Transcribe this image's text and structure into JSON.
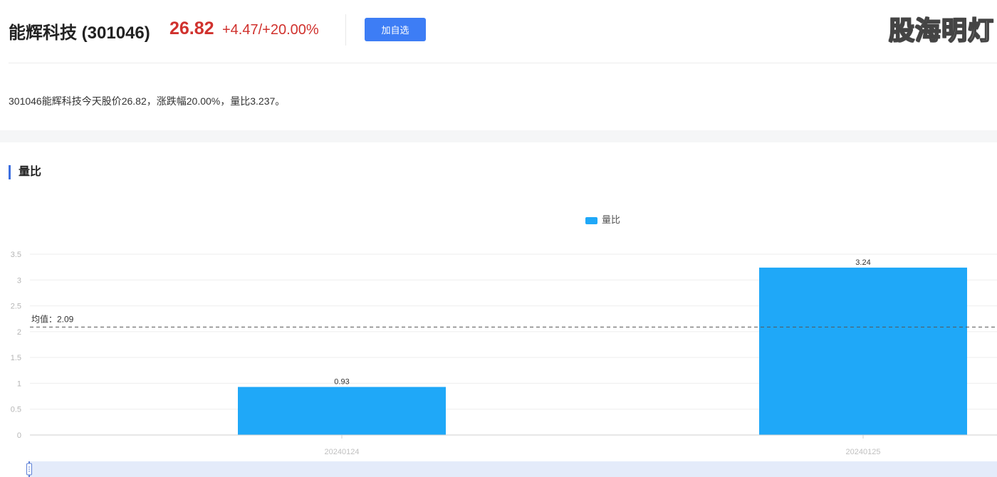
{
  "header": {
    "title": "能辉科技 (301046)",
    "price": "26.82",
    "change": "+4.47/+20.00%",
    "add_button_label": "加自选",
    "watermark": "股海明灯"
  },
  "summary": "301046能辉科技今天股价26.82，涨跌幅20.00%，量比3.237。",
  "section": {
    "title": "量比"
  },
  "colors": {
    "rise": "#d0312d",
    "accent": "#3d7df5",
    "bar": "#1fa8f8"
  },
  "chart_data": {
    "type": "bar",
    "categories": [
      "20240124",
      "20240125"
    ],
    "series": [
      {
        "name": "量比",
        "values": [
          0.93,
          3.24
        ],
        "labels": [
          "0.93",
          "3.24"
        ]
      }
    ],
    "yticks": [
      "0",
      "0.5",
      "1",
      "1.5",
      "2",
      "2.5",
      "3",
      "3.5"
    ],
    "ylim": [
      0,
      3.5
    ],
    "mean": {
      "value": 2.09,
      "label": "均值：2.09"
    },
    "legend_position": "top-center",
    "grid": true
  }
}
